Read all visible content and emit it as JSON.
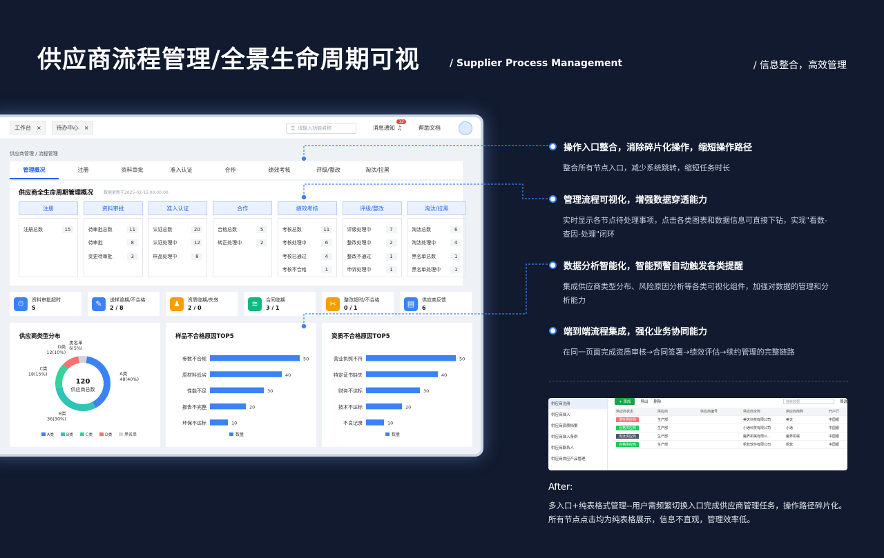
{
  "header": {
    "title": "供应商流程管理/全景生命周期可视",
    "subtitle": "/ Supplier Process Management",
    "right_caption": "/ 信息整合，高效管理"
  },
  "mock": {
    "tabs_open": [
      "工作台",
      "待办中心"
    ],
    "search_placeholder": "请输入功能名称",
    "notice_label": "消息通知",
    "notice_count": "12",
    "help_label": "帮助文档",
    "breadcrumb": "供应商管理 / 流程管理",
    "nav_tabs": [
      "管理概况",
      "注册",
      "资料审批",
      "准入认证",
      "合作",
      "绩效考核",
      "评级/整改",
      "淘汰/拉黑"
    ],
    "overview_title": "供应商全生命周期管理概况",
    "overview_time": "数据更新于2025-02-15 00:00:00",
    "stages": [
      {
        "name": "注册",
        "rows": [
          {
            "label": "注册总数",
            "value": "15"
          }
        ]
      },
      {
        "name": "资料审批",
        "rows": [
          {
            "label": "待审批总数",
            "value": "11"
          },
          {
            "label": "待审批",
            "value": "8"
          },
          {
            "label": "变更待审批",
            "value": "3"
          }
        ]
      },
      {
        "name": "准入认证",
        "rows": [
          {
            "label": "认证总数",
            "value": "20"
          },
          {
            "label": "认证处理中",
            "value": "12"
          },
          {
            "label": "样品处理中",
            "value": "8"
          }
        ]
      },
      {
        "name": "合作",
        "rows": [
          {
            "label": "合格总数",
            "value": "5"
          },
          {
            "label": "转正处理中",
            "value": "2"
          }
        ]
      },
      {
        "name": "绩效考核",
        "rows": [
          {
            "label": "考核总数",
            "value": "11"
          },
          {
            "label": "考核处理中",
            "value": "6"
          },
          {
            "label": "考核已通过",
            "value": "4"
          },
          {
            "label": "考核不合格",
            "value": "1"
          }
        ]
      },
      {
        "name": "评级/整改",
        "rows": [
          {
            "label": "评级处理中",
            "value": "7"
          },
          {
            "label": "整改处理中",
            "value": "2"
          },
          {
            "label": "整改不通过",
            "value": "1"
          },
          {
            "label": "申诉处理中",
            "value": "1"
          }
        ]
      },
      {
        "name": "淘汰/拉黑",
        "rows": [
          {
            "label": "淘汰总数",
            "value": "6"
          },
          {
            "label": "淘汰处理中",
            "value": "4"
          },
          {
            "label": "黑名单总数",
            "value": "1"
          },
          {
            "label": "黑名单处理中",
            "value": "1"
          }
        ]
      }
    ],
    "alerts": [
      {
        "label": "资料审批超时",
        "value": "5",
        "icon": "⏱",
        "color": "#3b82f6"
      },
      {
        "label": "送样逾期/不合格",
        "value": "2 / 8",
        "icon": "✎",
        "color": "#3b82f6"
      },
      {
        "label": "资质临期/失效",
        "value": "2 / 0",
        "icon": "♟",
        "color": "#f59e0b"
      },
      {
        "label": "合同临期",
        "value": "3 / 1",
        "icon": "≋",
        "color": "#10b981"
      },
      {
        "label": "整改超时/不合格",
        "value": "0 / 1",
        "icon": "✂",
        "color": "#f59e0b"
      },
      {
        "label": "供应商反馈",
        "value": "6",
        "icon": "▤",
        "color": "#3b82f6"
      }
    ]
  },
  "chart_data": [
    {
      "type": "pie",
      "title": "供应商类型分布",
      "center_value": "120",
      "center_label": "供应商总数",
      "categories": [
        "A类",
        "B类",
        "C类",
        "D类",
        "黑名单"
      ],
      "values": [
        48,
        36,
        18,
        12,
        6
      ],
      "slice_labels": [
        "A类\n48(40%)",
        "B类\n36(30%)",
        "C类\n18(15%)",
        "D类\n12(10%)",
        "黑名单\n6(5%)"
      ],
      "colors": [
        "#3b82f6",
        "#2ec4b6",
        "#34d399",
        "#f87171",
        "#d1d5db"
      ],
      "legend": [
        "A类",
        "B类",
        "C类",
        "D类",
        "黑名单"
      ]
    },
    {
      "type": "bar",
      "title": "样品不合格原因TOP5",
      "categories": [
        "参数不合规",
        "原材料低劣",
        "性能不足",
        "报告不完整",
        "环保不达标"
      ],
      "values": [
        50,
        40,
        30,
        20,
        10
      ],
      "series_name": "数量",
      "xlim": [
        0,
        50
      ],
      "color": "#3b82f6"
    },
    {
      "type": "bar",
      "title": "资质不合格原因TOP5",
      "categories": [
        "营业执照不符",
        "特定证书缺失",
        "财务不达标",
        "技术不达标",
        "不良记录"
      ],
      "values": [
        50,
        40,
        30,
        20,
        10
      ],
      "series_name": "数量",
      "xlim": [
        0,
        50
      ],
      "color": "#3b82f6"
    }
  ],
  "features": [
    {
      "title": "操作入口整合，消除碎片化操作，缩短操作路径",
      "desc": "整合所有节点入口，减少系统跳转，缩短任务时长"
    },
    {
      "title": "管理流程可视化，增强数据穿透能力",
      "desc": "实时显示各节点待处理事项，点击各类图表和数据信息可直接下钻，实现\"看数-查因-处理\"闭环"
    },
    {
      "title": "数据分析智能化，智能预警自动触发各类提醒",
      "desc": "集成供应商类型分布、风险原因分析等各类可视化组件，加强对数据的管理和分析能力"
    },
    {
      "title": "端到端流程集成，强化业务协同能力",
      "desc": "在同一页面完成资质审核→合同签署→绩效评估→续约管理的完整链路"
    }
  ],
  "after": {
    "side_items": [
      "供应商注册",
      "供应商准入",
      "供应商资质档案",
      "供应商准入条例",
      "供应商联系人",
      "供应商供应产品管理"
    ],
    "toolbar": {
      "add": "+ 添加",
      "export": "导出",
      "delete": "删除",
      "search_placeholder": "搜索数据",
      "filter": "筛选"
    },
    "columns": [
      "供应商状态",
      "供应商",
      "供应商编号",
      "供应商全称",
      "供应商简称",
      "开户行"
    ],
    "rows": [
      {
        "status": "潜在供应商",
        "status_color": "#f87171",
        "dept": "生产部",
        "code": "",
        "full": "美天科技有限公司",
        "short": "美天",
        "bank": "中国银"
      },
      {
        "status": "合格供应商",
        "status_color": "#22c55e",
        "dept": "生产部",
        "code": "",
        "full": "小通科技有限公司",
        "short": "小通",
        "bank": "中国银"
      },
      {
        "status": "淘汰供应商",
        "status_color": "#4b5563",
        "dept": "生产部",
        "code": "",
        "full": "魔界机械有限公...",
        "short": "魔界机械",
        "bank": "中国银"
      },
      {
        "status": "合格供应商",
        "status_color": "#22c55e",
        "dept": "生产部",
        "code": "",
        "full": "帆软软件有限公司",
        "short": "帆软",
        "bank": "中国银"
      }
    ],
    "label": "After:",
    "desc": "多入口+纯表格式管理--用户需频繁切换入口完成供应商管理任务，操作路径碎片化。所有节点点击均为纯表格展示，信息不直观，管理效率低。"
  }
}
